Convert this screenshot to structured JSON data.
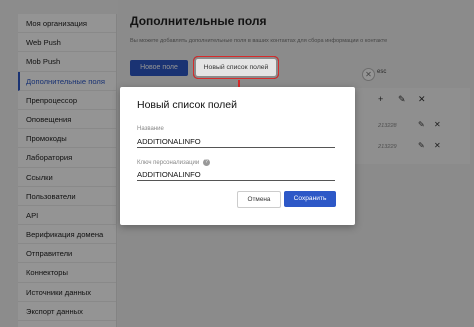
{
  "sidebar": {
    "items": [
      {
        "label": "Моя организация",
        "active": false
      },
      {
        "label": "Web Push",
        "active": false
      },
      {
        "label": "Mob Push",
        "active": false
      },
      {
        "label": "Дополнительные поля",
        "active": true
      },
      {
        "label": "Препроцессор",
        "active": false
      },
      {
        "label": "Оповещения",
        "active": false
      },
      {
        "label": "Промокоды",
        "active": false
      },
      {
        "label": "Лаборатория",
        "active": false
      },
      {
        "label": "Ссылки",
        "active": false
      },
      {
        "label": "Пользователи",
        "active": false
      },
      {
        "label": "API",
        "active": false
      },
      {
        "label": "Верификация домена",
        "active": false
      },
      {
        "label": "Отправители",
        "active": false
      },
      {
        "label": "Коннекторы",
        "active": false
      },
      {
        "label": "Источники данных",
        "active": false
      },
      {
        "label": "Экспорт данных",
        "active": false
      }
    ]
  },
  "main": {
    "title": "Дополнительные поля",
    "description": "Вы можете добавлять дополнительные поля в ваших контактах для сбора информации о контакте",
    "new_field_button": "Новое поле",
    "new_list_button": "Новый список полей",
    "esc_label": "esc",
    "table": {
      "header_icons": [
        "plus-icon",
        "pencil-icon",
        "close-icon"
      ],
      "rows": [
        {
          "id": "213228"
        },
        {
          "id": "213229"
        }
      ]
    }
  },
  "modal": {
    "title": "Новый список полей",
    "name_label": "Название",
    "name_value": "ADDITIONALINFO",
    "key_label": "Ключ персонализации",
    "key_value": "ADDITIONALINFO",
    "cancel_button": "Отмена",
    "save_button": "Сохранить"
  },
  "colors": {
    "accent": "#2d58c7",
    "highlight": "#d62b2b"
  }
}
